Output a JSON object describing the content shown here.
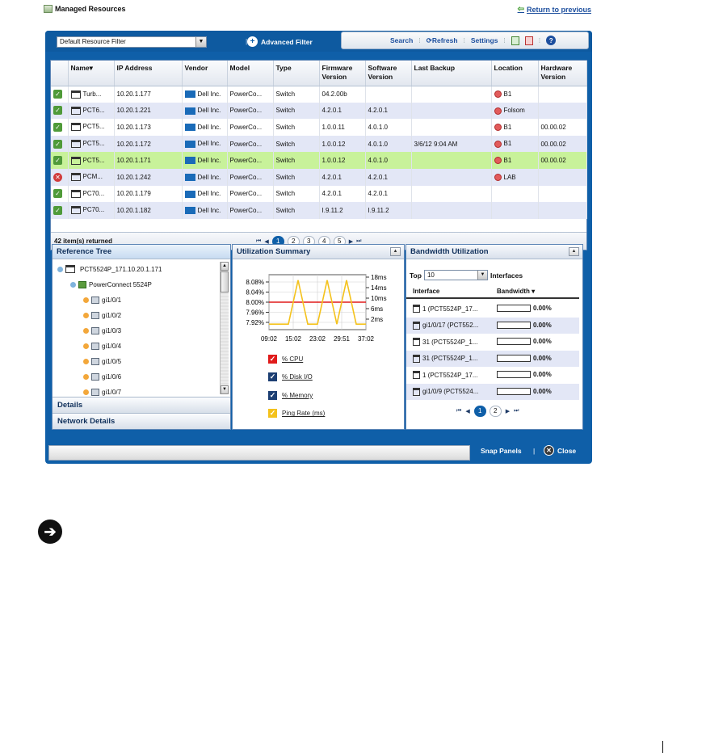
{
  "page": {
    "title": "Managed Resources",
    "return_link": "Return to previous"
  },
  "filter": {
    "value": "Default Resource Filter",
    "advanced_label": "Advanced Filter"
  },
  "toolbar": {
    "search": "Search",
    "refresh": "Refresh",
    "settings": "Settings"
  },
  "grid": {
    "columns": [
      "Name",
      "IP Address",
      "Vendor",
      "Model",
      "Type",
      "Firmware Version",
      "Software Version",
      "Last Backup",
      "Location",
      "Hardware Version"
    ],
    "rows": [
      {
        "status": "ok",
        "name": "Turb...",
        "ip": "10.20.1.177",
        "vendor": "Dell Inc.",
        "model": "PowerCo...",
        "type": "Switch",
        "fw": "04.2.00b",
        "sw": "",
        "backup": "",
        "location": "B1",
        "hw": ""
      },
      {
        "status": "ok",
        "name": "PCT6...",
        "ip": "10.20.1.221",
        "vendor": "Dell Inc.",
        "model": "PowerCo...",
        "type": "Switch",
        "fw": "4.2.0.1",
        "sw": "4.2.0.1",
        "backup": "",
        "location": "Folsom",
        "hw": ""
      },
      {
        "status": "ok",
        "name": "PCT5...",
        "ip": "10.20.1.173",
        "vendor": "Dell Inc.",
        "model": "PowerCo...",
        "type": "Switch",
        "fw": "1.0.0.11",
        "sw": "4.0.1.0",
        "backup": "",
        "location": "B1",
        "hw": "00.00.02"
      },
      {
        "status": "ok",
        "name": "PCT5...",
        "ip": "10.20.1.172",
        "vendor": "Dell Inc.",
        "model": "PowerCo...",
        "type": "Switch",
        "fw": "1.0.0.12",
        "sw": "4.0.1.0",
        "backup": "3/6/12 9:04 AM",
        "location": "B1",
        "hw": "00.00.02"
      },
      {
        "status": "ok",
        "name": "PCT5...",
        "ip": "10.20.1.171",
        "vendor": "Dell Inc.",
        "model": "PowerCo...",
        "type": "Switch",
        "fw": "1.0.0.12",
        "sw": "4.0.1.0",
        "backup": "",
        "location": "B1",
        "hw": "00.00.02",
        "selected": true
      },
      {
        "status": "err",
        "name": "PCM...",
        "ip": "10.20.1.242",
        "vendor": "Dell Inc.",
        "model": "PowerCo...",
        "type": "Switch",
        "fw": "4.2.0.1",
        "sw": "4.2.0.1",
        "backup": "",
        "location": "LAB",
        "hw": ""
      },
      {
        "status": "ok",
        "name": "PC70...",
        "ip": "10.20.1.179",
        "vendor": "Dell Inc.",
        "model": "PowerCo...",
        "type": "Switch",
        "fw": "4.2.0.1",
        "sw": "4.2.0.1",
        "backup": "",
        "location": "",
        "hw": ""
      },
      {
        "status": "ok",
        "name": "PC70...",
        "ip": "10.20.1.182",
        "vendor": "Dell Inc.",
        "model": "PowerCo...",
        "type": "Switch",
        "fw": "I.9.11.2",
        "sw": "I.9.11.2",
        "backup": "",
        "location": "",
        "hw": ""
      }
    ],
    "items_returned": "42 item(s) returned",
    "pages": [
      "1",
      "2",
      "3",
      "4",
      "5"
    ],
    "active_page": "1"
  },
  "reference_tree": {
    "title": "Reference Tree",
    "root": "PCT5524P_171.10.20.1.171",
    "device": "PowerConnect 5524P",
    "ports": [
      "gi1/0/1",
      "gi1/0/2",
      "gi1/0/3",
      "gi1/0/4",
      "gi1/0/5",
      "gi1/0/6",
      "gi1/0/7"
    ],
    "accordions": [
      "Details",
      "Network Details"
    ]
  },
  "utilization": {
    "title": "Utilization Summary",
    "legend": [
      {
        "label": "% CPU",
        "color": "#e01b1b"
      },
      {
        "label": "% Disk I/O",
        "color": "#1d3f73"
      },
      {
        "label": "% Memory",
        "color": "#1d3f73"
      },
      {
        "label": "Ping Rate (ms)",
        "color": "#f4c21c"
      }
    ]
  },
  "chart_data": {
    "type": "line",
    "title": "Utilization Summary",
    "x": [
      "09:02",
      "15:02",
      "23:02",
      "29:51",
      "37:02"
    ],
    "left_axis": {
      "ticks": [
        "8.08%",
        "8.04%",
        "8.00%",
        "7.96%",
        "7.92%"
      ],
      "ylim": [
        7.9,
        8.1
      ]
    },
    "right_axis": {
      "ticks": [
        "18ms",
        "14ms",
        "10ms",
        "6ms",
        "2ms"
      ],
      "ylim": [
        0,
        20
      ]
    },
    "series": [
      {
        "name": "% CPU",
        "axis": "left",
        "color": "#e01b1b",
        "values": [
          8.0,
          8.0,
          8.0,
          8.0,
          8.0,
          8.0,
          8.0,
          8.0,
          8.0,
          8.0,
          8.0
        ]
      },
      {
        "name": "Ping Rate (ms)",
        "axis": "right",
        "color": "#f4c21c",
        "values": [
          2,
          2,
          2,
          18,
          2,
          2,
          18,
          2,
          18,
          2,
          2
        ]
      }
    ]
  },
  "bandwidth": {
    "title": "Bandwidth Utilization",
    "top_label": "Top",
    "top_value": "10",
    "interfaces_label": "Interfaces",
    "col_interface": "Interface",
    "col_bandwidth": "Bandwidth",
    "rows": [
      {
        "iface": "1 (PCT5524P_17...",
        "pct": "0.00%",
        "fill": 0
      },
      {
        "iface": "gi1/0/17 (PCT552...",
        "pct": "0.00%",
        "fill": 0
      },
      {
        "iface": "31 (PCT5524P_1...",
        "pct": "0.00%",
        "fill": 0
      },
      {
        "iface": "31 (PCT5524P_1...",
        "pct": "0.00%",
        "fill": 0
      },
      {
        "iface": "1 (PCT5524P_17...",
        "pct": "0.00%",
        "fill": 0
      },
      {
        "iface": "gi1/0/9 (PCT5524...",
        "pct": "0.00%",
        "fill": 0
      }
    ],
    "pages": [
      "1",
      "2"
    ],
    "active_page": "1"
  },
  "footer": {
    "snap": "Snap Panels",
    "close": "Close"
  }
}
